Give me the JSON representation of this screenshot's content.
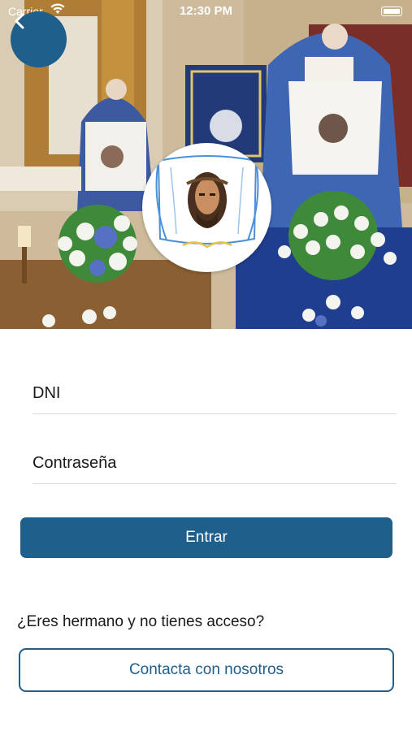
{
  "status_bar": {
    "carrier": "Carrier",
    "time": "12:30 PM"
  },
  "hero": {
    "back_icon": "chevron-left-icon",
    "logo": "veronica-veil-logo"
  },
  "form": {
    "dni_placeholder": "DNI",
    "password_placeholder": "Contraseña",
    "submit_label": "Entrar"
  },
  "contact": {
    "question": "¿Eres hermano y no tienes acceso?",
    "button_label": "Contacta con nosotros"
  },
  "colors": {
    "primary": "#1f5f8b",
    "background": "#ffffff",
    "text": "#1a1a1a"
  }
}
